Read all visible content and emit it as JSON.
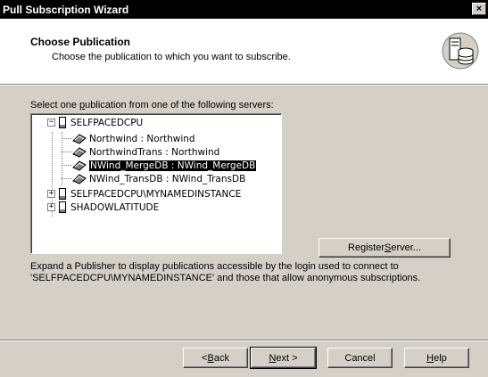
{
  "window": {
    "title": "Pull Subscription Wizard",
    "close_glyph": "×"
  },
  "header": {
    "title": "Choose Publication",
    "subtitle": "Choose the publication to which you want to subscribe.",
    "icon": "server-database-icon"
  },
  "prompt": {
    "before": "Select one ",
    "accel": "p",
    "after": "ublication from one of the following servers:"
  },
  "tree": [
    {
      "label": "SELFPACEDCPU",
      "type": "server",
      "expander": "−",
      "expanded": true
    },
    {
      "label": "Northwind : Northwind",
      "type": "publication"
    },
    {
      "label": "NorthwindTrans : Northwind",
      "type": "publication"
    },
    {
      "label": "NWind_MergeDB : NWind_MergeDB",
      "type": "publication",
      "selected": true
    },
    {
      "label": "NWind_TransDB : NWind_TransDB",
      "type": "publication"
    },
    {
      "label": "SELFPACEDCPU\\MYNAMEDINSTANCE",
      "type": "server",
      "expander": "+"
    },
    {
      "label": "SHADOWLATITUDE",
      "type": "server",
      "expander": "+"
    }
  ],
  "buttons": {
    "register": {
      "before": "Register ",
      "accel": "S",
      "after": "erver..."
    },
    "back": {
      "before": "< ",
      "accel": "B",
      "after": "ack"
    },
    "next": {
      "before": "",
      "accel": "N",
      "after": "ext >"
    },
    "cancel": {
      "before": "Cancel",
      "accel": "",
      "after": ""
    },
    "help": {
      "before": "",
      "accel": "H",
      "after": "elp"
    }
  },
  "note": {
    "line1": "Expand a Publisher to display publications accessible by the login used to connect to",
    "line2": "'SELFPACEDCPU\\MYNAMEDINSTANCE' and those that allow anonymous subscriptions."
  }
}
